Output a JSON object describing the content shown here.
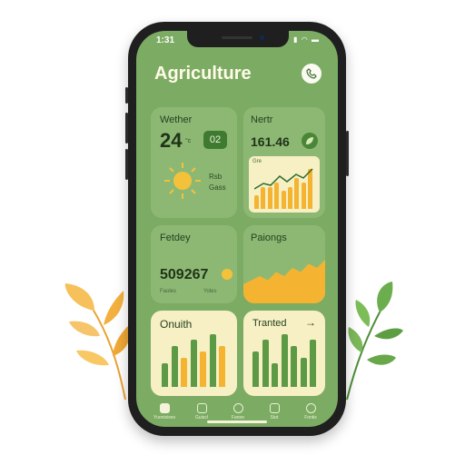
{
  "status_bar": {
    "time": "1:31",
    "icons": "▮ ◠ ▬"
  },
  "app": {
    "title": "Agriculture"
  },
  "colors": {
    "screen_bg": "#7cab64",
    "card_green": "#8db874",
    "card_cream": "#f7f0c4",
    "accent_yellow": "#f4b431",
    "bar_green": "#5c9a45"
  },
  "weather": {
    "title": "Wether",
    "temp": "24",
    "unit": "°c",
    "badge": "02",
    "desc_line1": "Rsb",
    "desc_line2": "Gass",
    "icon": "sun-icon"
  },
  "market": {
    "title": "Nertr",
    "value": "161.46",
    "badge_icon": "leaf-icon",
    "chart_label": "Gre",
    "chart_data": {
      "type": "bar",
      "values": [
        3,
        5,
        5,
        6,
        4,
        5,
        7,
        6,
        9
      ]
    }
  },
  "harvest": {
    "title": "Fetdey",
    "value": "509267",
    "sub_left": "Faoles",
    "sub_right": "Yoles"
  },
  "pricing": {
    "title": "Paiongs",
    "chart_data": {
      "type": "area",
      "values": [
        2,
        3,
        4,
        3,
        5,
        4,
        6,
        5,
        7,
        6,
        8
      ]
    }
  },
  "growth": {
    "title": "Onuith",
    "chart_data": {
      "type": "bar",
      "values": [
        4,
        7,
        5,
        8,
        6,
        9,
        7
      ],
      "colors": [
        "green",
        "green",
        "yellow",
        "green",
        "yellow",
        "green",
        "yellow"
      ]
    }
  },
  "trend": {
    "title": "Tranted",
    "arrow": "→",
    "chart_data": {
      "type": "bar",
      "values": [
        6,
        8,
        4,
        9,
        7,
        5,
        8
      ]
    }
  },
  "tabs": [
    {
      "label": "Yuonisises",
      "icon": "home-icon",
      "active": true
    },
    {
      "label": "Guiscl",
      "icon": "calendar-icon",
      "active": false
    },
    {
      "label": "Fanoe",
      "icon": "chat-icon",
      "active": false
    },
    {
      "label": "Stot",
      "icon": "chart-icon",
      "active": false
    },
    {
      "label": "Fontis",
      "icon": "settings-icon",
      "active": false
    }
  ]
}
